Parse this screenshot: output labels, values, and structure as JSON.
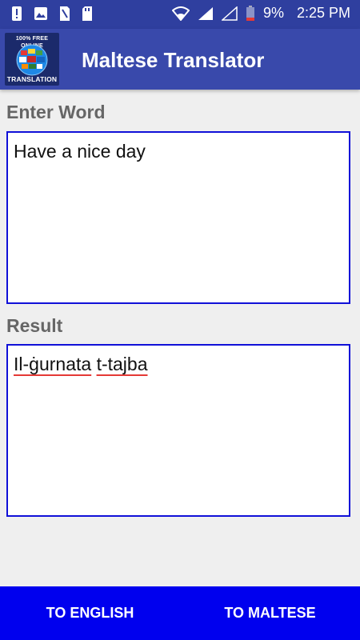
{
  "status_bar": {
    "battery_percent": "9%",
    "time": "2:25 PM",
    "icons": [
      "notification-alert-icon",
      "gallery-icon",
      "sim-card-icon",
      "storage-card-icon",
      "wifi-icon",
      "signal-icon",
      "signal-empty-icon",
      "battery-low-icon"
    ]
  },
  "app_bar": {
    "logo_top_text": "100% FREE ONLINE",
    "logo_bottom_text": "TRANSLATION",
    "title": "Maltese Translator"
  },
  "input_section": {
    "label": "Enter Word",
    "value": "Have a nice day"
  },
  "result_section": {
    "label": "Result",
    "words": [
      "Il-ġurnata",
      "t-tajba"
    ]
  },
  "buttons": {
    "to_english": "TO ENGLISH",
    "to_maltese": "TO MALTESE"
  },
  "colors": {
    "status_bar": "#2f3f9f",
    "app_bar": "#3949ab",
    "box_border": "#1010d8",
    "bottom_bar": "#0000ee",
    "spell_underline": "#e53935"
  }
}
